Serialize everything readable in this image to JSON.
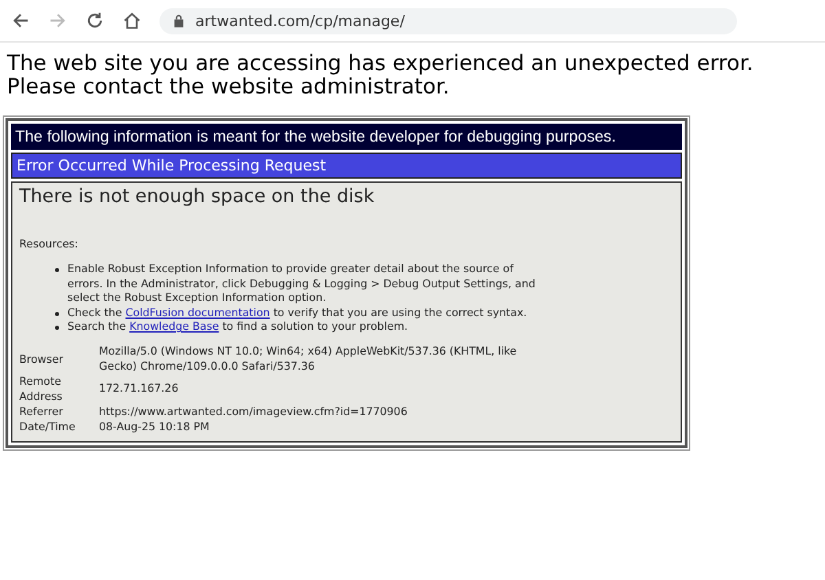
{
  "browser": {
    "url": "artwanted.com/cp/manage/",
    "back_disabled": false,
    "forward_disabled": true
  },
  "error_message": [
    "The web site you are accessing has experienced an unexpected error.",
    "Please contact the website administrator."
  ],
  "debug_header": "The following information is meant for the website developer for debugging purposes.",
  "error_title": "Error Occurred While Processing Request",
  "error_detail": "There is not enough space on the disk",
  "resources_label": "Resources:",
  "resources": [
    [
      {
        "text": "Enable Robust Exception Information to provide greater detail about the source of errors. In the Administrator, click Debugging & Logging > Debug Output Settings, and select the Robust Exception Information option.",
        "link": false
      }
    ],
    [
      {
        "text": "Check the ",
        "link": false
      },
      {
        "text": "ColdFusion documentation",
        "link": true
      },
      {
        "text": " to verify that you are using the correct syntax.",
        "link": false
      }
    ],
    [
      {
        "text": "Search the ",
        "link": false
      },
      {
        "text": "Knowledge Base",
        "link": true
      },
      {
        "text": " to find a solution to your problem.",
        "link": false
      }
    ]
  ],
  "details": [
    {
      "label": "Browser",
      "value": "Mozilla/5.0 (Windows NT 10.0; Win64; x64) AppleWebKit/537.36 (KHTML, like Gecko) Chrome/109.0.0.0 Safari/537.36"
    },
    {
      "label": "Remote Address",
      "value": "172.71.167.26"
    },
    {
      "label": "Referrer",
      "value": "https://www.artwanted.com/imageview.cfm?id=1770906"
    },
    {
      "label": "Date/Time",
      "value": "08-Aug-25 10:18 PM"
    }
  ]
}
